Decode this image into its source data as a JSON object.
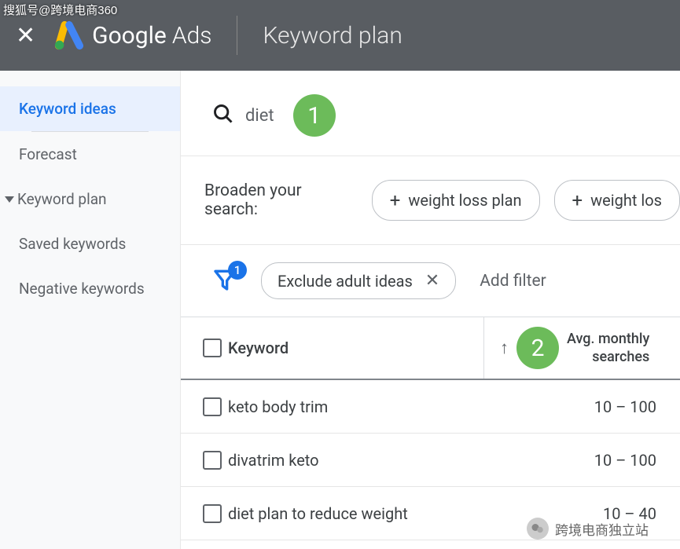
{
  "watermarks": {
    "top_left": "搜狐号@跨境电商360",
    "bottom_right": "跨境电商独立站"
  },
  "header": {
    "brand_light": "Google",
    "brand_thin": "Ads",
    "page_title": "Keyword plan"
  },
  "sidebar": {
    "items": [
      {
        "label": "Keyword ideas",
        "active": true
      },
      {
        "label": "Forecast"
      },
      {
        "label": "Keyword plan",
        "parent": true
      },
      {
        "label": "Saved keywords"
      },
      {
        "label": "Negative keywords"
      }
    ]
  },
  "search": {
    "value": "diet",
    "badge": "1"
  },
  "broaden": {
    "label": "Broaden your search:",
    "chips": [
      "weight loss plan",
      "weight los"
    ]
  },
  "filters": {
    "funnel_count": "1",
    "active_filter": "Exclude adult ideas",
    "add_label": "Add filter"
  },
  "table": {
    "columns": {
      "keyword": "Keyword",
      "searches_line1": "Avg. monthly",
      "searches_line2": "searches",
      "sort_badge": "2"
    },
    "rows": [
      {
        "keyword": "keto body trim",
        "searches": "10 – 100"
      },
      {
        "keyword": "divatrim keto",
        "searches": "10 – 100"
      },
      {
        "keyword": "diet plan to reduce weight",
        "searches": "10 – 40"
      }
    ]
  }
}
